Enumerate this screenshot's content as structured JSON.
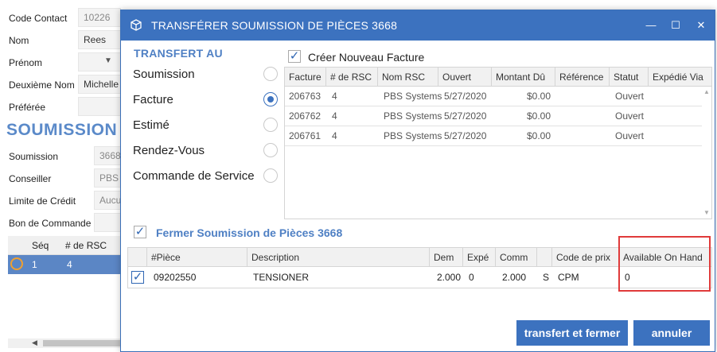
{
  "background_form": {
    "fields": [
      {
        "label": "Code Contact",
        "value": "10226",
        "muted": true
      },
      {
        "label": "Nom",
        "value": "Rees",
        "muted": false
      },
      {
        "label": "Prénom",
        "value": "",
        "muted": false
      },
      {
        "label": "Deuxième Nom",
        "value": "Michelle",
        "muted": false
      },
      {
        "label": "Préférée",
        "value": "",
        "muted": false
      }
    ],
    "section_title": "SOUMISSION",
    "section_fields": [
      {
        "label": "Soumission",
        "value": "3668",
        "muted": true
      },
      {
        "label": "Conseiller",
        "value": "PBS",
        "muted": true
      },
      {
        "label": "Limite de Crédit",
        "value": "Aucu",
        "muted": true
      },
      {
        "label": "Bon de Commande",
        "value": "",
        "muted": false
      }
    ],
    "grid": {
      "headers": [
        "Séq",
        "# de RSC"
      ],
      "row": {
        "seq": "1",
        "rsc": "4"
      }
    }
  },
  "dialog": {
    "title": "TRANSFÉRER SOUMISSION DE PIÈCES 3668",
    "controls": {
      "minimize": "—",
      "maximize": "☐",
      "close": "✕"
    },
    "transfer_heading": "TRANSFERT AU",
    "transfer_options": [
      {
        "label": "Soumission",
        "selected": false
      },
      {
        "label": "Facture",
        "selected": true
      },
      {
        "label": "Estimé",
        "selected": false
      },
      {
        "label": "Rendez-Vous",
        "selected": false
      },
      {
        "label": "Commande de Service",
        "selected": false
      }
    ],
    "create_new": {
      "label": "Créer Nouveau Facture",
      "checked": true
    },
    "invoice_table": {
      "columns": [
        "Facture",
        "# de RSC",
        "Nom RSC",
        "Ouvert",
        "Montant Dû",
        "Référence",
        "Statut",
        "Expédié Via"
      ],
      "rows": [
        {
          "facture": "206763",
          "rsc": "4",
          "nom": "PBS Systems",
          "ouvert": "5/27/2020",
          "montant": "$0.00",
          "reference": "",
          "statut": "Ouvert",
          "expedie": ""
        },
        {
          "facture": "206762",
          "rsc": "4",
          "nom": "PBS Systems",
          "ouvert": "5/27/2020",
          "montant": "$0.00",
          "reference": "",
          "statut": "Ouvert",
          "expedie": ""
        },
        {
          "facture": "206761",
          "rsc": "4",
          "nom": "PBS Systems",
          "ouvert": "5/27/2020",
          "montant": "$0.00",
          "reference": "",
          "statut": "Ouvert",
          "expedie": ""
        }
      ]
    },
    "close_quote": {
      "label": "Fermer Soumission de Pièces 3668",
      "checked": true
    },
    "parts_table": {
      "columns": [
        "#Pièce",
        "Description",
        "Dem",
        "Expé",
        "Comm",
        "",
        "Code de prix",
        "Available On Hand"
      ],
      "row": {
        "checked": true,
        "piece": "09202550",
        "description": "TENSIONER",
        "dem": "2.000",
        "expe": "0",
        "comm": "2.000",
        "flag": "S",
        "code_prix": "CPM",
        "on_hand": "0"
      }
    },
    "buttons": {
      "transfer": "transfert et fermer",
      "cancel": "annuler"
    }
  },
  "colors": {
    "accent": "#3c72bf",
    "highlight": "#e03a3a",
    "heading": "#4f80c4"
  }
}
